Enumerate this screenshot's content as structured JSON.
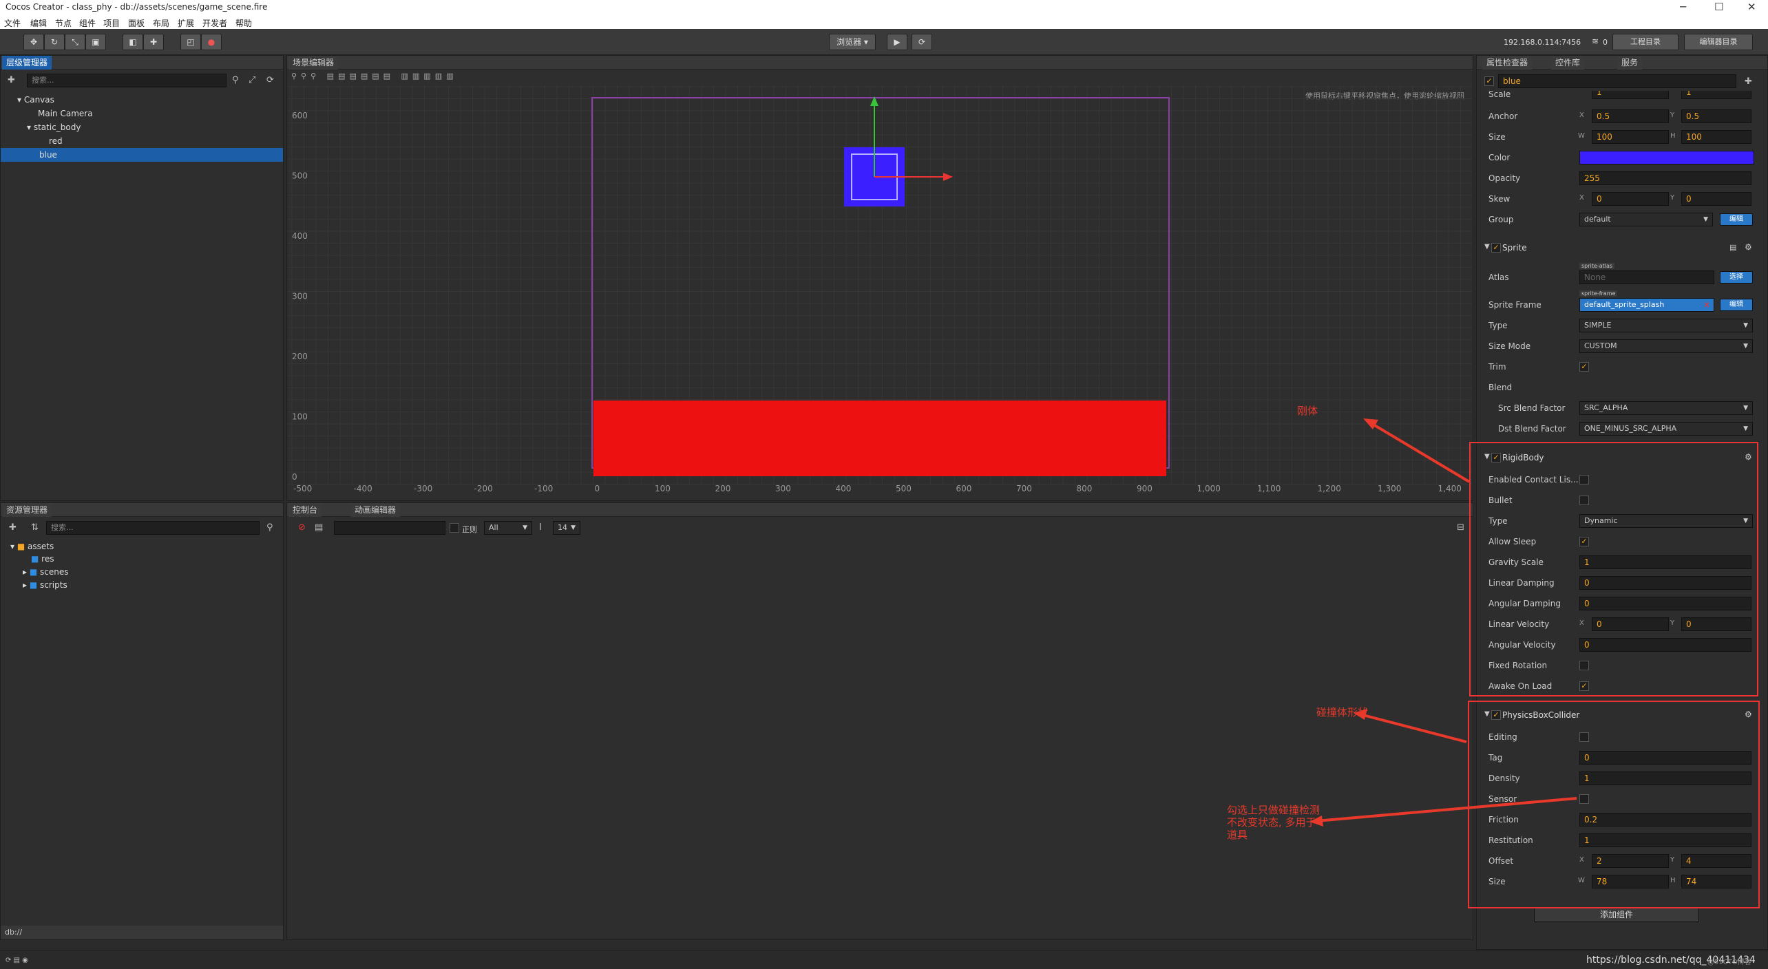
{
  "window": {
    "title": "Cocos Creator - class_phy - db://assets/scenes/game_scene.fire"
  },
  "menu": [
    "文件",
    "编辑",
    "节点",
    "组件",
    "项目",
    "面板",
    "布局",
    "扩展",
    "开发者",
    "帮助"
  ],
  "toolbar": {
    "preview_label": "浏览器 ▾",
    "ip": "192.168.0.114:7456",
    "ip_count": "0",
    "project_btn": "工程目录",
    "editor_btn": "编辑器目录"
  },
  "hierarchy": {
    "tab": "层级管理器",
    "search_placeholder": "搜索...",
    "nodes": [
      "Canvas",
      "Main Camera",
      "static_body",
      "red",
      "blue"
    ]
  },
  "scene": {
    "tab": "场景编辑器",
    "hint": "使用鼠标右键平移视窗焦点，使用滚轮缩放视图",
    "yticks": [
      "600",
      "500",
      "400",
      "300",
      "200",
      "100",
      "0"
    ],
    "xticks": [
      "-500",
      "-400",
      "-300",
      "-200",
      "-100",
      "0",
      "100",
      "200",
      "300",
      "400",
      "500",
      "600",
      "700",
      "800",
      "900",
      "1,000",
      "1,100",
      "1,200",
      "1,300",
      "1,400"
    ]
  },
  "assets": {
    "tab": "资源管理器",
    "search_placeholder": "搜索...",
    "items": [
      "assets",
      "res",
      "scenes",
      "scripts"
    ],
    "path": "db://"
  },
  "console": {
    "tab1": "控制台",
    "tab2": "动画编辑器",
    "regex": "正则",
    "filter": "All",
    "fontsize": "14"
  },
  "inspector": {
    "tabs": [
      "属性检查器",
      "控件库",
      "服务"
    ],
    "node_name": "blue",
    "scale_label": "Scale",
    "scale_x": "1",
    "scale_y": "1",
    "anchor_label": "Anchor",
    "anchor_x": "0.5",
    "anchor_y": "0.5",
    "size_label": "Size",
    "size_w": "100",
    "size_h": "100",
    "color_label": "Color",
    "color_value": "#3b1fff",
    "opacity_label": "Opacity",
    "opacity": "255",
    "skew_label": "Skew",
    "skew_x": "0",
    "skew_y": "0",
    "group_label": "Group",
    "group": "default",
    "edit_btn": "编辑",
    "sprite": {
      "title": "Sprite",
      "atlas_label": "Atlas",
      "atlas_tag": "sprite-atlas",
      "atlas_value": "None",
      "select_btn": "选择",
      "frame_label": "Sprite Frame",
      "frame_tag": "sprite-frame",
      "frame_value": "default_sprite_splash",
      "frame_btn": "编辑",
      "type_label": "Type",
      "type": "SIMPLE",
      "sizemode_label": "Size Mode",
      "sizemode": "CUSTOM",
      "trim_label": "Trim",
      "blend_label": "Blend",
      "src_label": "Src Blend Factor",
      "src": "SRC_ALPHA",
      "dst_label": "Dst Blend Factor",
      "dst": "ONE_MINUS_SRC_ALPHA"
    },
    "rigidbody": {
      "title": "RigidBody",
      "contact_label": "Enabled Contact Lis...",
      "bullet_label": "Bullet",
      "type_label": "Type",
      "type": "Dynamic",
      "sleep_label": "Allow Sleep",
      "gravity_label": "Gravity Scale",
      "gravity": "1",
      "lindamp_label": "Linear Damping",
      "lindamp": "0",
      "angdamp_label": "Angular Damping",
      "angdamp": "0",
      "linvel_label": "Linear Velocity",
      "linvel_x": "0",
      "linvel_y": "0",
      "angvel_label": "Angular Velocity",
      "angvel": "0",
      "fixedrot_label": "Fixed Rotation",
      "awake_label": "Awake On Load"
    },
    "collider": {
      "title": "PhysicsBoxCollider",
      "editing_label": "Editing",
      "tag_label": "Tag",
      "tag": "0",
      "density_label": "Density",
      "density": "1",
      "sensor_label": "Sensor",
      "friction_label": "Friction",
      "friction": "0.2",
      "restitution_label": "Restitution",
      "restitution": "1",
      "offset_label": "Offset",
      "offset_x": "2",
      "offset_y": "4",
      "size_label": "Size",
      "size_w": "78",
      "size_h": "74"
    },
    "add_component": "添加组件"
  },
  "annotations": {
    "rigid": "刚体",
    "collider": "碰撞体形状",
    "sensor_line1": "勾选上只做碰撞检测",
    "sensor_line2": "不改变状态, 多用于",
    "sensor_line3": "道具",
    "accent_color": "#e8392b"
  },
  "watermark": "https://blog.csdn.net/qq_40411434",
  "corner_text": "@51CTO博客"
}
